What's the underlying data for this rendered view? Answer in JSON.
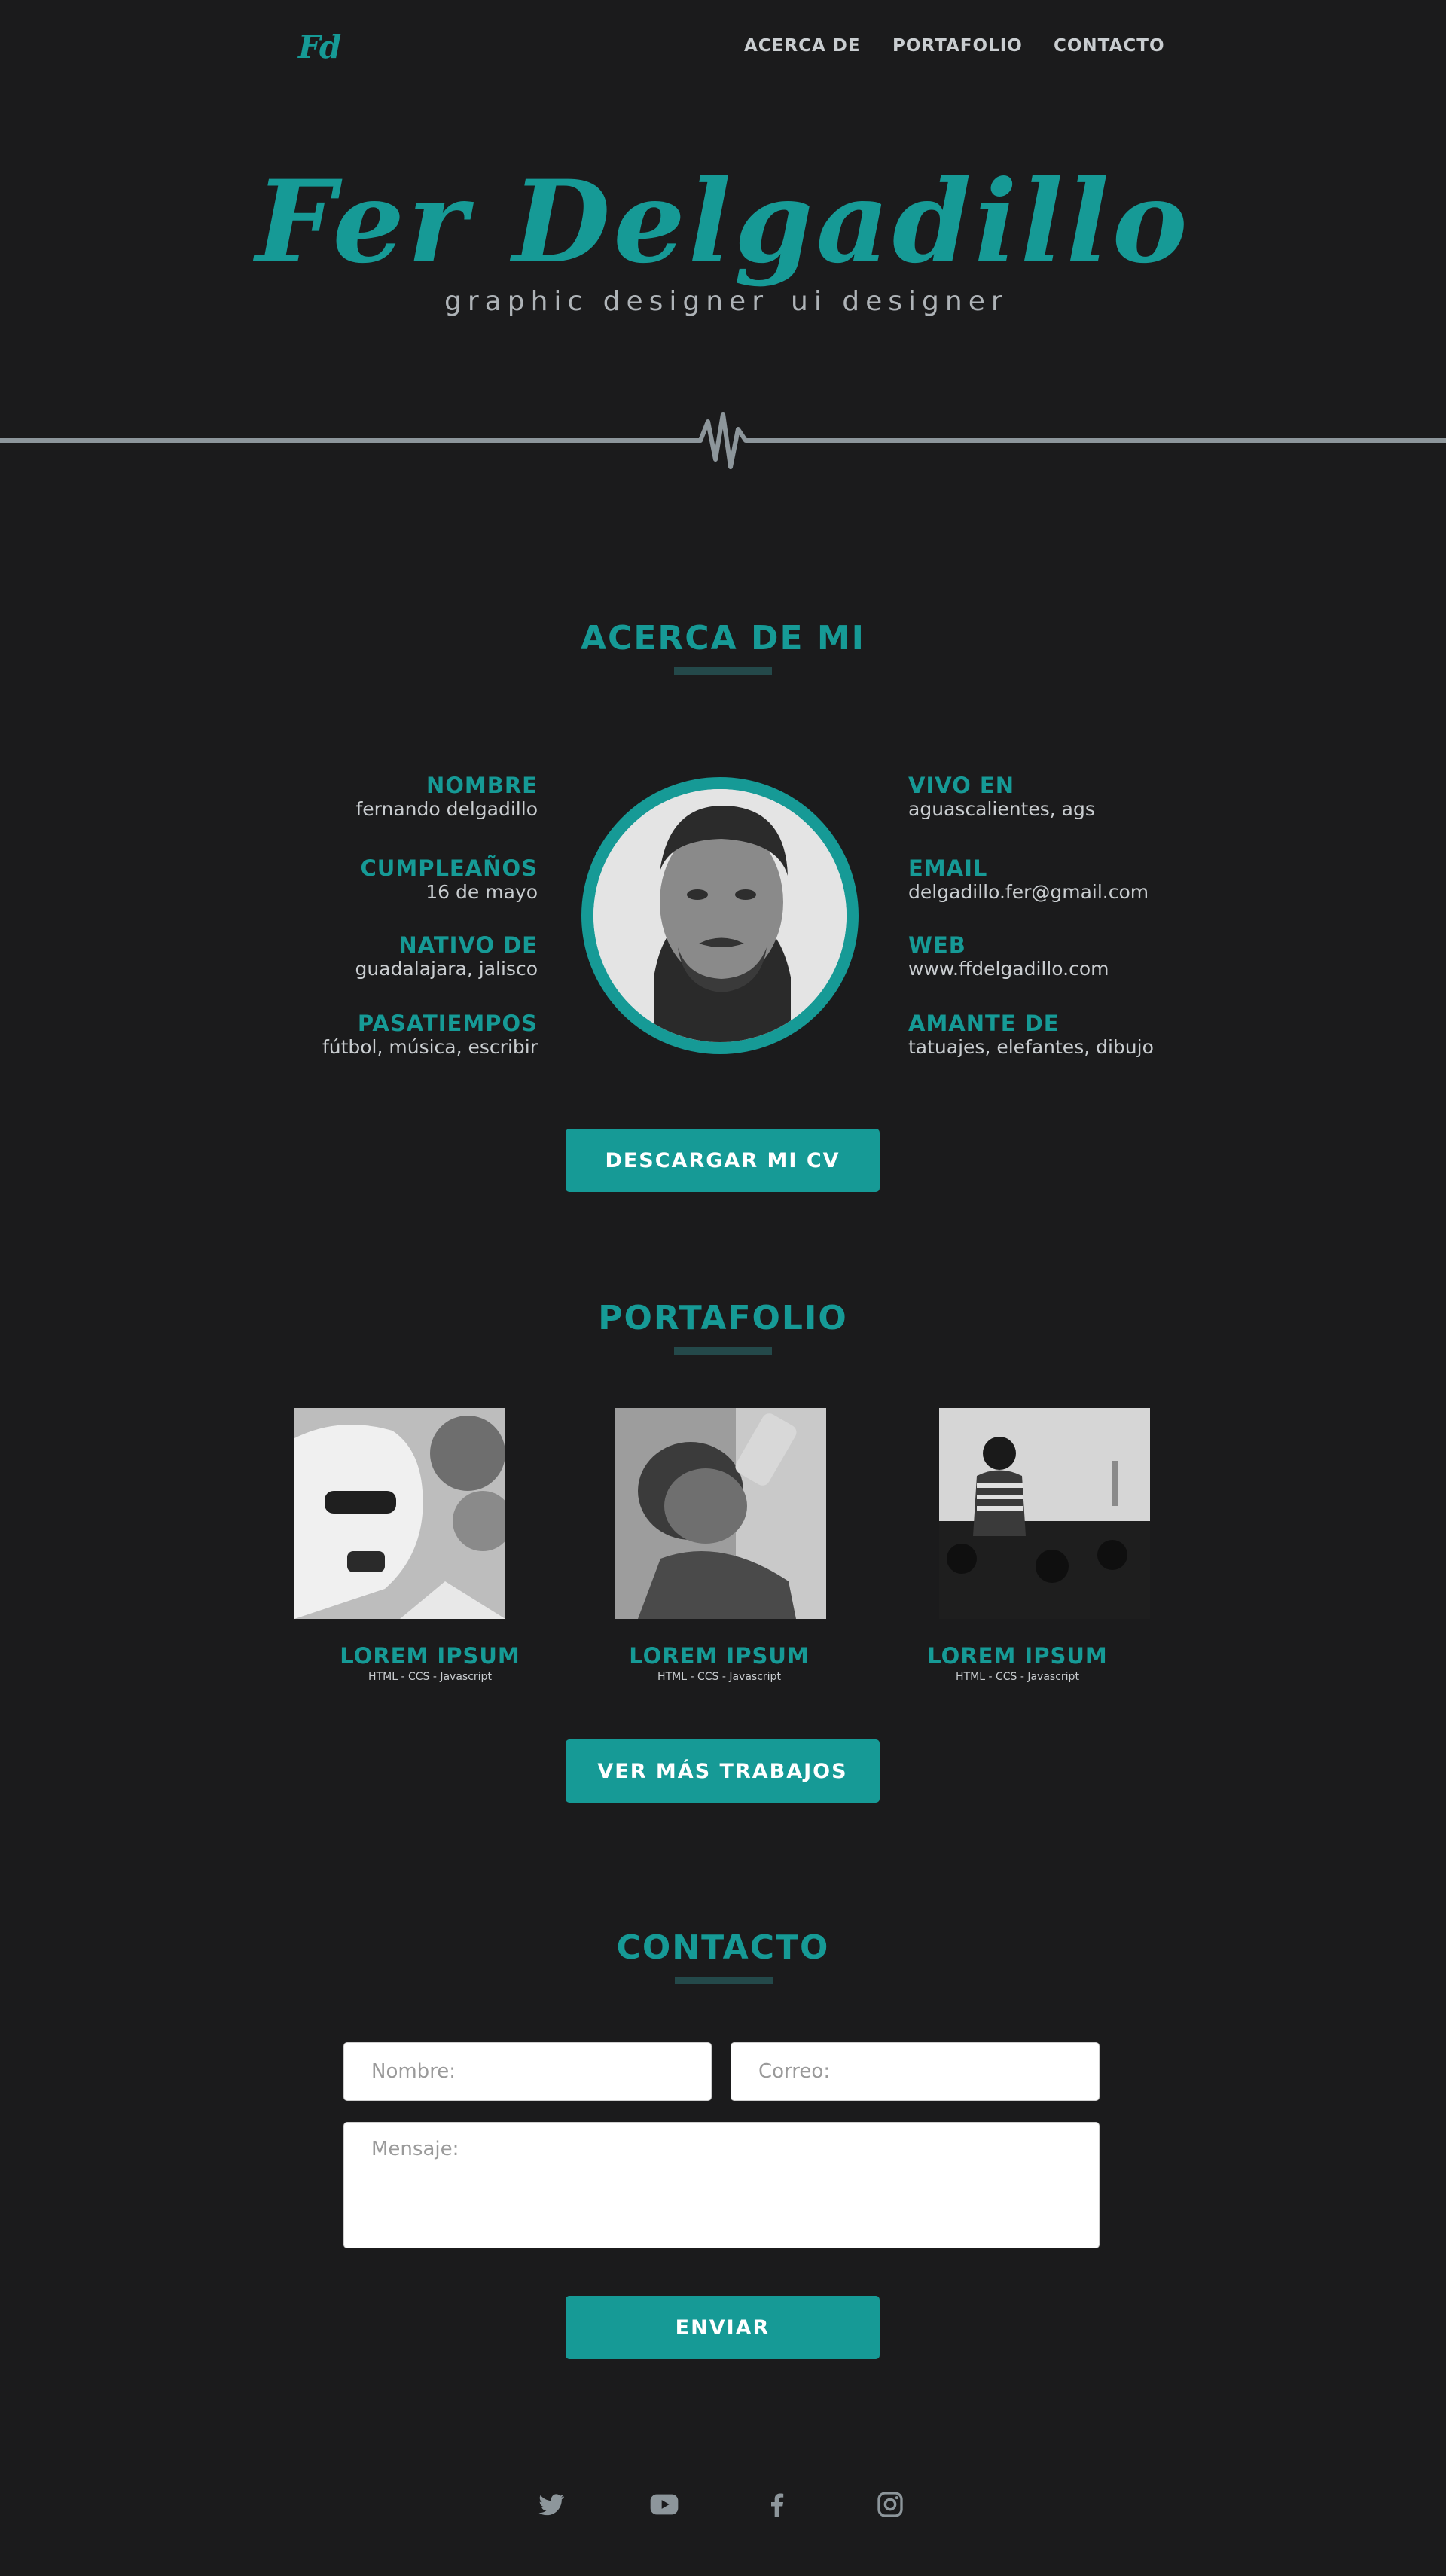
{
  "nav": {
    "logo": "Fd",
    "links": [
      "ACERCA DE",
      "PORTAFOLIO",
      "CONTACTO"
    ]
  },
  "hero": {
    "name": "Fer Delgadillo",
    "role_1": "graphic designer",
    "role_2": "ui designer"
  },
  "about": {
    "title": "ACERCA DE MI",
    "left": [
      {
        "label": "NOMBRE",
        "value": "fernando delgadillo"
      },
      {
        "label": "CUMPLEAÑOS",
        "value": "16 de mayo"
      },
      {
        "label": "NATIVO DE",
        "value": "guadalajara, jalisco"
      },
      {
        "label": "PASATIEMPOS",
        "value": "fútbol, música, escribir"
      }
    ],
    "right": [
      {
        "label": "VIVO EN",
        "value": "aguascalientes, ags"
      },
      {
        "label": "EMAIL",
        "value": "delgadillo.fer@gmail.com"
      },
      {
        "label": "WEB",
        "value": "www.ffdelgadillo.com"
      },
      {
        "label": "AMANTE DE",
        "value": "tatuajes, elefantes, dibujo"
      }
    ],
    "cv_button": "DESCARGAR MI CV"
  },
  "portfolio": {
    "title": "PORTAFOLIO",
    "items": [
      {
        "title": "LOREM IPSUM",
        "tags": "HTML - CCS - Javascript"
      },
      {
        "title": "LOREM IPSUM",
        "tags": "HTML - CCS - Javascript"
      },
      {
        "title": "LOREM IPSUM",
        "tags": "HTML - CCS - Javascript"
      }
    ],
    "more_button": "VER MÁS TRABAJOS"
  },
  "contact": {
    "title": "CONTACTO",
    "name_placeholder": "Nombre:",
    "email_placeholder": "Correo:",
    "message_placeholder": "Mensaje:",
    "submit": "ENVIAR"
  },
  "footer": {
    "social": [
      "twitter-icon",
      "youtube-icon",
      "facebook-icon",
      "instagram-icon"
    ]
  },
  "colors": {
    "accent": "#169a96",
    "background": "#1b1b1c",
    "text": "#c9cdd0"
  }
}
